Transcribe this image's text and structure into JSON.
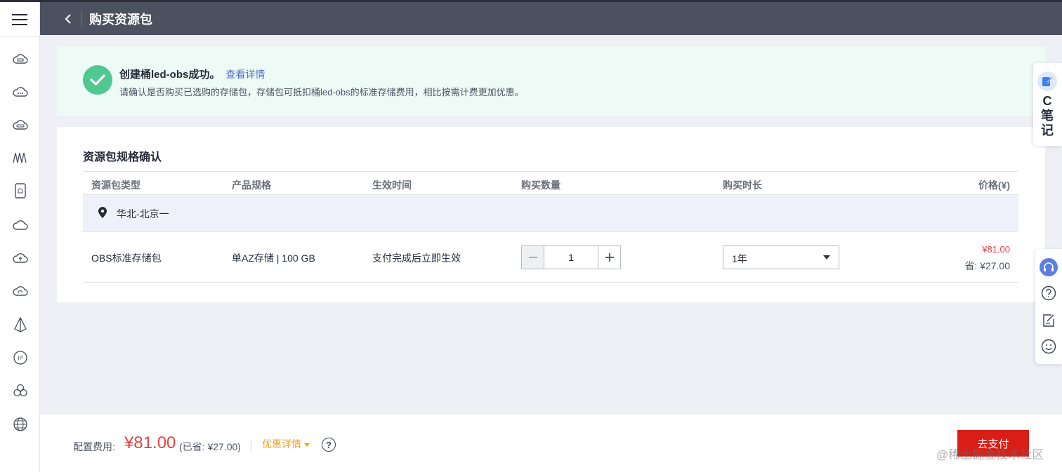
{
  "header": {
    "title": "购买资源包"
  },
  "notice": {
    "title": "创建桶led-obs成功。",
    "link": "查看详情",
    "description": "请确认是否购买已选购的存储包，存储包可抵扣桶led-obs的标准存储费用，相比按需计费更加优惠。"
  },
  "card": {
    "title": "资源包规格确认",
    "columns": [
      "资源包类型",
      "产品规格",
      "生效时间",
      "购买数量",
      "购买时长",
      "价格(¥)"
    ],
    "region": "华北-北京一",
    "row": {
      "type": "OBS标准存储包",
      "spec": "单AZ存储 | 100 GB",
      "effective": "支付完成后立即生效",
      "quantity": "1",
      "duration": "1年",
      "price": "¥81.00",
      "saving": "省: ¥27.00"
    }
  },
  "footer": {
    "label": "配置费用:",
    "price": "¥81.00",
    "saving": "(已省: ¥27.00)",
    "promo": "优惠详情",
    "pay_button": "去支付"
  },
  "note_widget": {
    "label": "C笔记"
  },
  "watermark": "@稀土掘金技术社区",
  "colors": {
    "header_bg": "#4c5160",
    "accent_red": "#d81e16",
    "success_green": "#50c891",
    "link_blue": "#526ecc",
    "promo_orange": "#f5a020"
  }
}
